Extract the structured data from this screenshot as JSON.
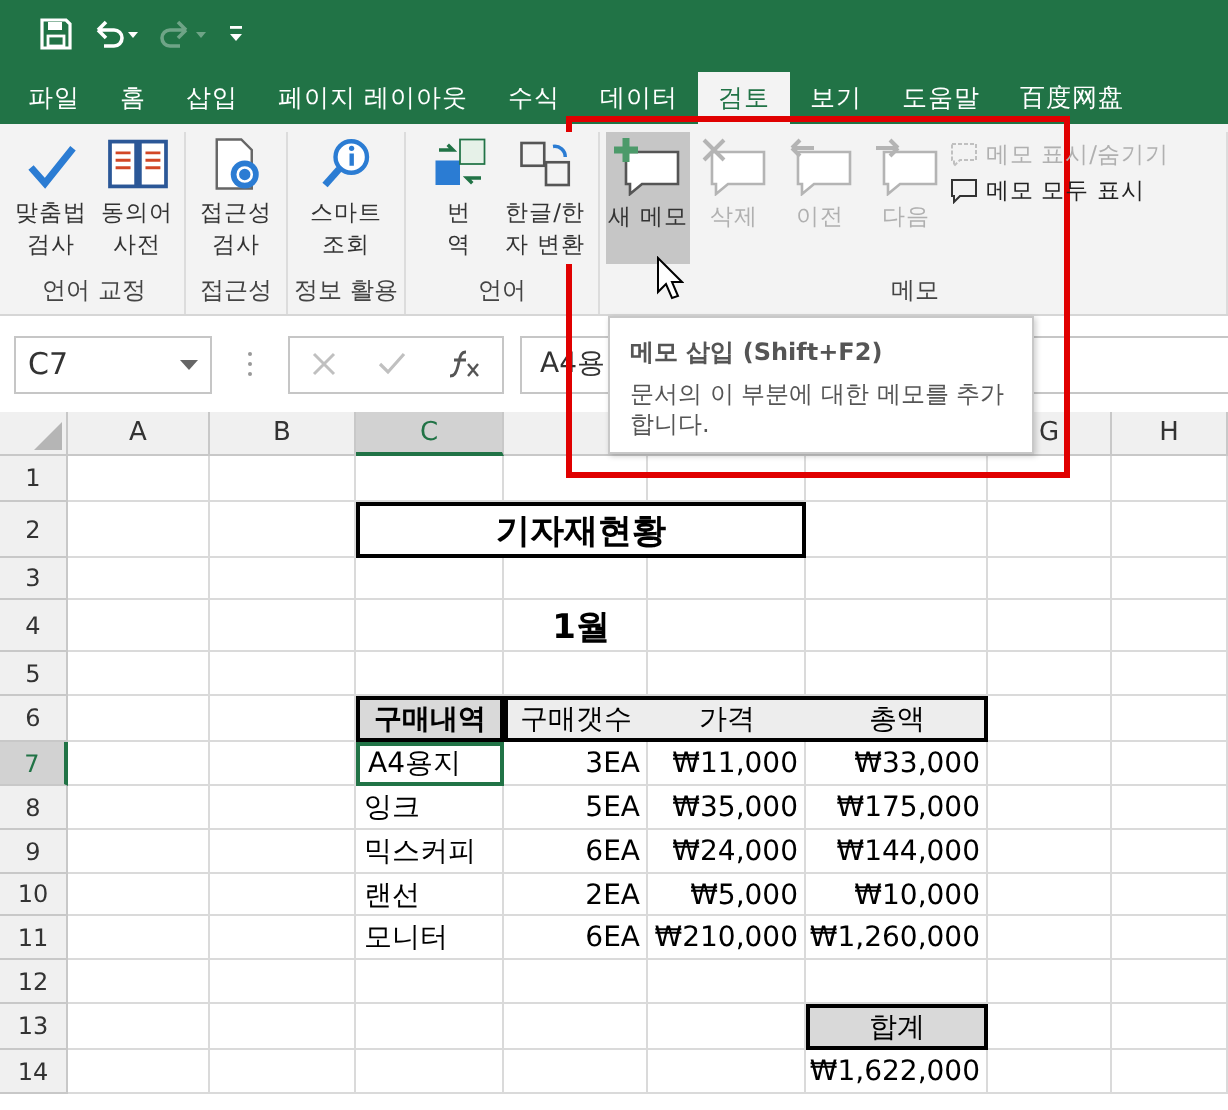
{
  "quick_access": [
    {
      "kind": "save",
      "disabled": false
    },
    {
      "kind": "undo",
      "disabled": false
    },
    {
      "kind": "redo",
      "disabled": true
    },
    {
      "kind": "customize",
      "disabled": false
    }
  ],
  "tabs": [
    {
      "label": "파일",
      "selected": false
    },
    {
      "label": "홈",
      "selected": false
    },
    {
      "label": "삽입",
      "selected": false
    },
    {
      "label": "페이지 레이아웃",
      "selected": false
    },
    {
      "label": "수식",
      "selected": false
    },
    {
      "label": "데이터",
      "selected": false
    },
    {
      "label": "검토",
      "selected": true
    },
    {
      "label": "보기",
      "selected": false
    },
    {
      "label": "도움말",
      "selected": false
    },
    {
      "label": "百度网盘",
      "selected": false
    }
  ],
  "ribbon": {
    "groups": [
      {
        "label": "언어 교정",
        "buttons": [
          {
            "kind": "spelling",
            "lines": [
              "맞춤법",
              "검사"
            ],
            "disabled": false,
            "selected": false
          },
          {
            "kind": "thesaurus",
            "lines": [
              "동의어",
              "사전"
            ],
            "disabled": false,
            "selected": false
          }
        ]
      },
      {
        "label": "접근성",
        "buttons": [
          {
            "kind": "accessibility",
            "lines": [
              "접근성",
              "검사"
            ],
            "disabled": false,
            "selected": false
          }
        ]
      },
      {
        "label": "정보 활용",
        "buttons": [
          {
            "kind": "lookup",
            "lines": [
              "스마트",
              "조회"
            ],
            "disabled": false,
            "selected": false
          }
        ]
      },
      {
        "label": "언어",
        "buttons": [
          {
            "kind": "translate",
            "lines": [
              "번",
              "역"
            ],
            "disabled": false,
            "selected": false
          },
          {
            "kind": "hanja",
            "lines": [
              "한글/한",
              "자 변환"
            ],
            "disabled": false,
            "selected": false
          }
        ]
      },
      {
        "label": "메모",
        "buttons": [
          {
            "kind": "new",
            "lines": [
              "새 메모"
            ],
            "disabled": false,
            "selected": true
          },
          {
            "kind": "delete",
            "lines": [
              "삭제"
            ],
            "disabled": true,
            "selected": false
          },
          {
            "kind": "previous",
            "lines": [
              "이전"
            ],
            "disabled": true,
            "selected": false
          },
          {
            "kind": "next",
            "lines": [
              "다음"
            ],
            "disabled": true,
            "selected": false
          }
        ],
        "small_buttons": [
          {
            "kind": "show-hide",
            "label": "메모 표시/숨기기",
            "disabled": true
          },
          {
            "kind": "show-all",
            "label": "메모 모두 표시",
            "disabled": false
          }
        ]
      }
    ]
  },
  "formula_bar": {
    "name_box": "C7",
    "value": "A4용"
  },
  "tooltip": {
    "title": "메모 삽입 (Shift+F2)",
    "description": "문서의 이 부분에 대한 메모를 추가합니다."
  },
  "sheet": {
    "columns": [
      {
        "label": "A",
        "selected": false
      },
      {
        "label": "B",
        "selected": false
      },
      {
        "label": "C",
        "selected": true
      },
      {
        "selected": false
      },
      {
        "selected": false
      },
      {
        "selected": false
      },
      {
        "label": "G",
        "selected": false
      },
      {
        "label": "H",
        "selected": false
      }
    ],
    "rows": [
      {
        "label": "1",
        "selected": false
      },
      {
        "label": "2",
        "selected": false
      },
      {
        "label": "3",
        "selected": false
      },
      {
        "label": "4",
        "selected": false
      },
      {
        "label": "5",
        "selected": false
      },
      {
        "label": "6",
        "selected": false
      },
      {
        "label": "7",
        "selected": true
      },
      {
        "label": "8",
        "selected": false
      },
      {
        "label": "9",
        "selected": false
      },
      {
        "label": "10",
        "selected": false
      },
      {
        "label": "11",
        "selected": false
      },
      {
        "label": "12",
        "selected": false
      },
      {
        "label": "13",
        "selected": false
      },
      {
        "label": "14",
        "selected": false
      }
    ],
    "title": "기자재현황",
    "month": "1월",
    "table": {
      "headers": [
        "구매내역",
        "구매갯수",
        "가격",
        "총액"
      ],
      "rows": [
        {
          "cells": [
            "A4용지",
            "3EA",
            "₩11,000",
            "₩33,000"
          ],
          "selected": true
        },
        {
          "cells": [
            "잉크",
            "5EA",
            "₩35,000",
            "₩175,000"
          ],
          "selected": false
        },
        {
          "cells": [
            "믹스커피",
            "6EA",
            "₩24,000",
            "₩144,000"
          ],
          "selected": false
        },
        {
          "cells": [
            "랜선",
            "2EA",
            "₩5,000",
            "₩10,000"
          ],
          "selected": false
        },
        {
          "cells": [
            "모니터",
            "6EA",
            "₩210,000",
            "₩1,260,000"
          ],
          "selected": false
        }
      ]
    },
    "total": {
      "label": "합계",
      "value": "₩1,622,000"
    }
  }
}
